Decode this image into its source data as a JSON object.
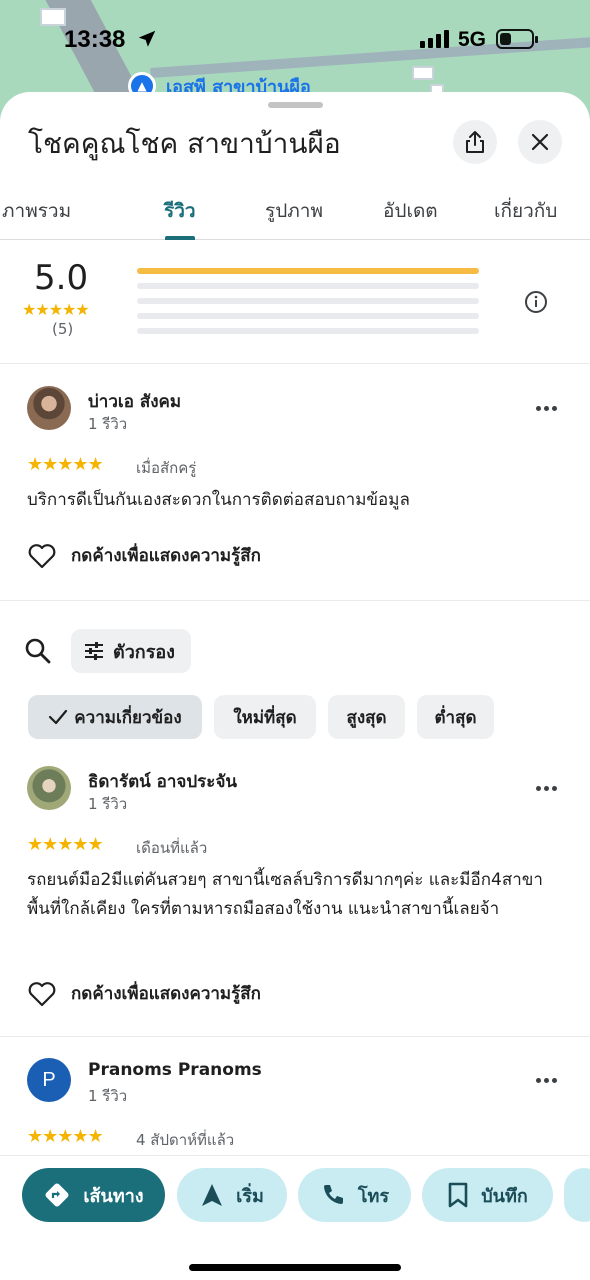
{
  "status": {
    "time": "13:38",
    "network": "5G"
  },
  "map": {
    "label": "เอสพี สาขาบ้านผือ"
  },
  "place": {
    "title": "โชคคูณโชค สาขาบ้านผือ"
  },
  "tabs": [
    "ภาพรวม",
    "รีวิว",
    "รูปภาพ",
    "อัปเดต",
    "เกี่ยวกับ"
  ],
  "active_tab": "รีวิว",
  "rating": {
    "value": "5.0",
    "stars": "★★★★★",
    "count": "(5)",
    "distribution": [
      1.0,
      0,
      0,
      0,
      0
    ]
  },
  "reviews": [
    {
      "name": "บ่าวเอ สังคม",
      "count": "1 รีวิว",
      "stars": "★★★★★",
      "when": "เมื่อสักครู่",
      "text": "บริการดีเป็นกันเองสะดวกในการติดต่อสอบถามข้อมูล",
      "like": "กดค้างเพื่อแสดงความรู้สึก"
    },
    {
      "name": "ธิดารัตน์ อาจประจัน",
      "count": "1 รีวิว",
      "stars": "★★★★★",
      "when": "เดือนที่แล้ว",
      "text": "รถยนต์มือ2มีแต่คันสวยๆ สาขานี้เซลล์บริการดีมากๆค่ะ และมีอีก4สาขา พื้นที่ใกล้เคียง ใครที่ตามหารถมือสองใช้งาน แนะนำสาขานี้เลยจ้า",
      "like": "กดค้างเพื่อแสดงความรู้สึก"
    },
    {
      "name": "Pranoms Pranoms",
      "initial": "P",
      "count": "1 รีวิว",
      "stars": "★★★★★",
      "when": "4 สัปดาห์ที่แล้ว"
    }
  ],
  "filter": {
    "label": "ตัวกรอง"
  },
  "sort_chips": [
    "ความเกี่ยวข้อง",
    "ใหม่ที่สุด",
    "สูงสุด",
    "ต่ำสุด"
  ],
  "sort_selected": "ความเกี่ยวข้อง",
  "actions": [
    "เส้นทาง",
    "เริ่ม",
    "โทร",
    "บันทึก"
  ],
  "colors": {
    "accent": "#1b6f7b",
    "star": "#f4b400",
    "action_bg": "#c9ecf3"
  },
  "icons": [
    "location-arrow-icon",
    "share-icon",
    "close-icon",
    "info-icon",
    "more-icon",
    "heart-icon",
    "search-icon",
    "sliders-icon",
    "check-icon",
    "directions-icon",
    "navigation-icon",
    "phone-icon",
    "bookmark-icon"
  ]
}
